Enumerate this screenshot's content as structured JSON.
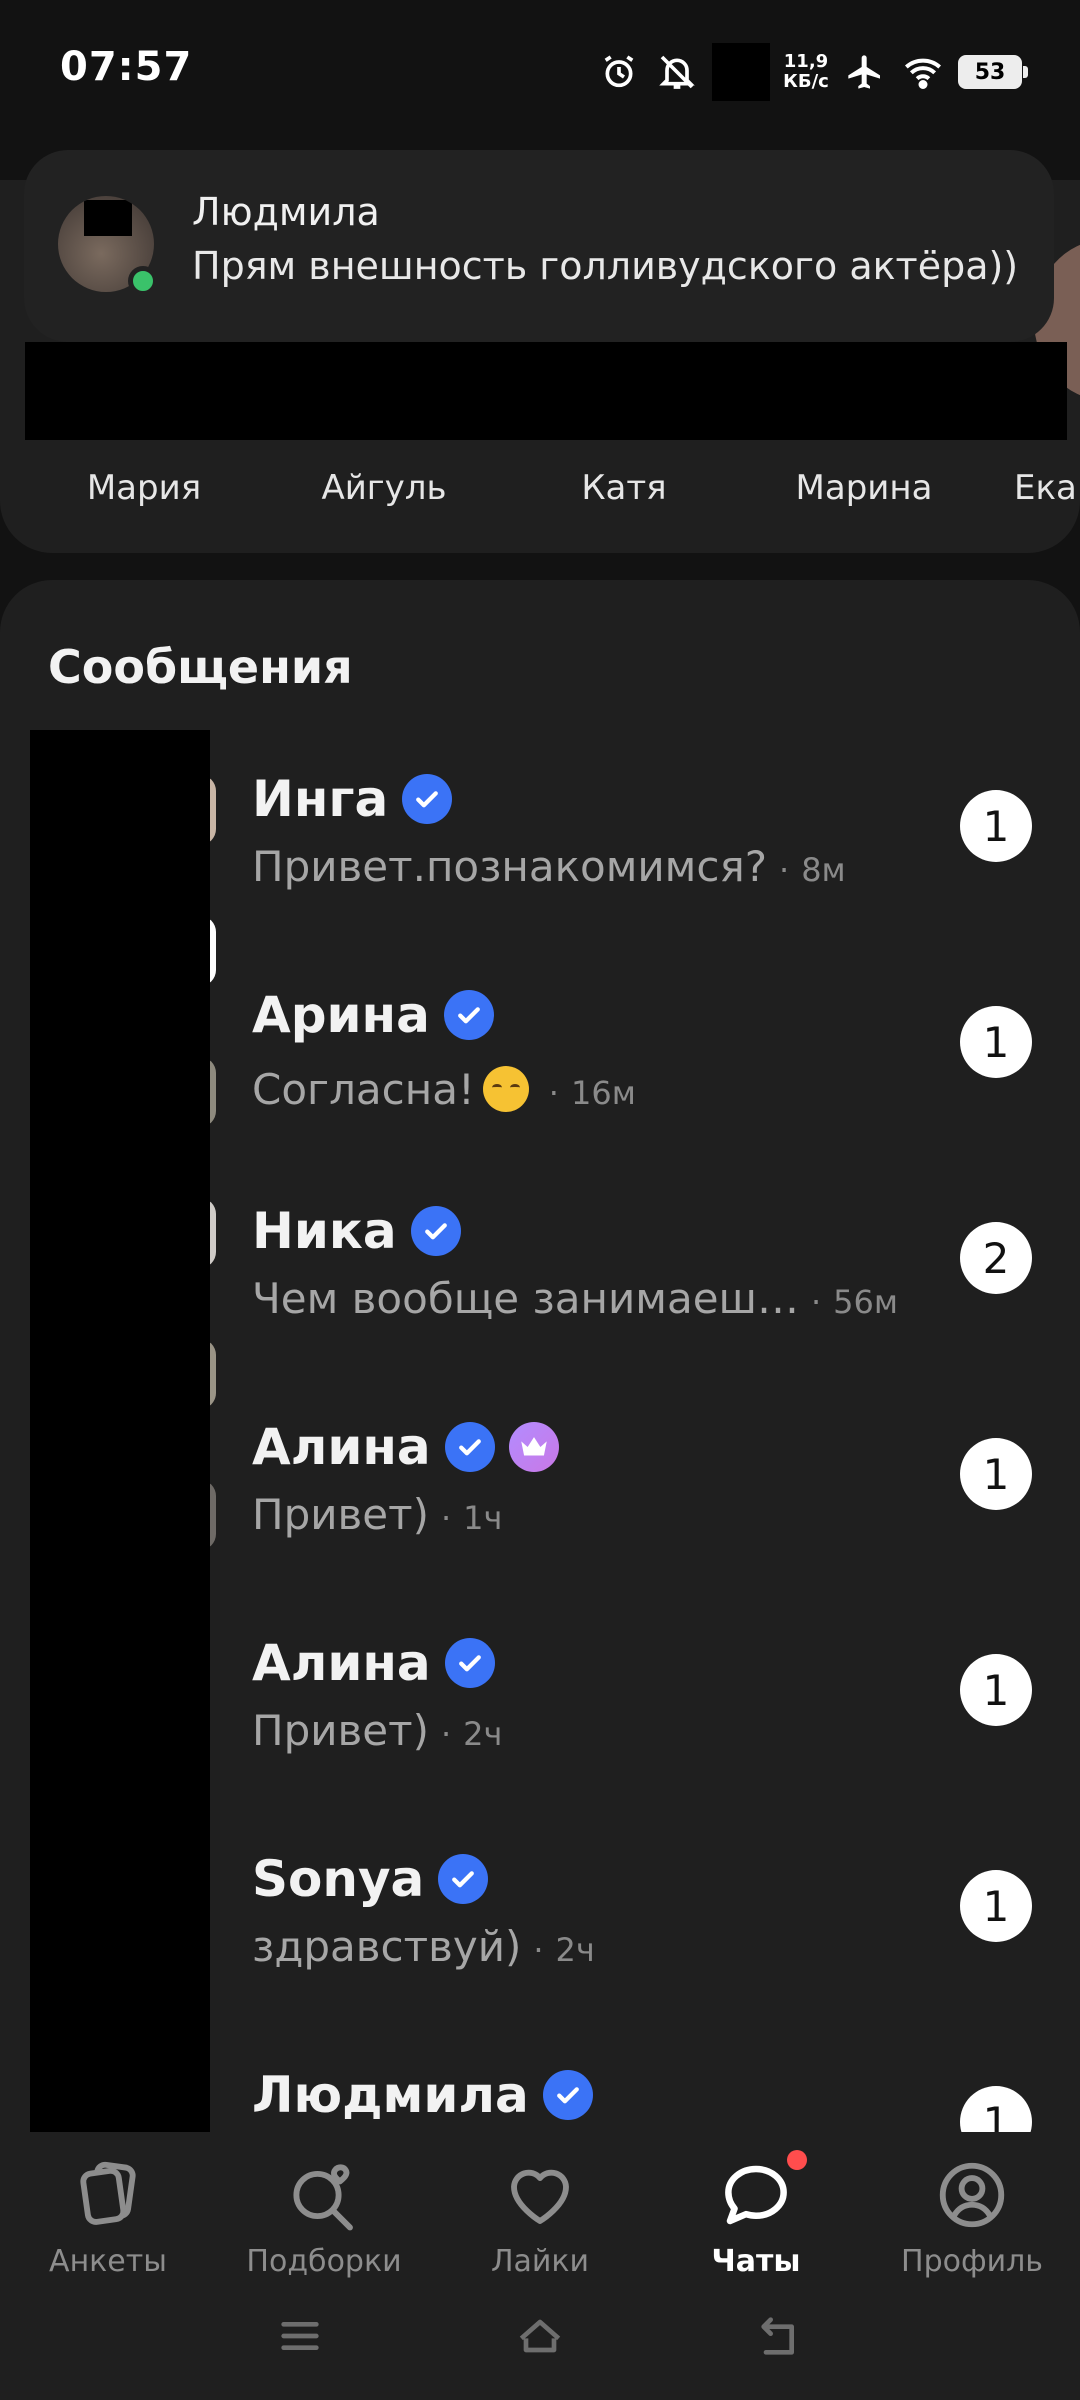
{
  "status_bar": {
    "time": "07:57",
    "net_speed_value": "11,9",
    "net_speed_unit": "КБ/с",
    "battery": "53"
  },
  "notification": {
    "sender": "Людмила",
    "text": "Прям внешность голливудского актёра))"
  },
  "stories": [
    {
      "name": "Мария"
    },
    {
      "name": "Айгуль"
    },
    {
      "name": "Катя"
    },
    {
      "name": "Марина"
    },
    {
      "name": "Ека"
    }
  ],
  "messages": {
    "title": "Сообщения",
    "chats": [
      {
        "name": "Инга",
        "preview": "Привет.познакомимся?",
        "time": "8м",
        "unread": "1"
      },
      {
        "name": "Арина",
        "preview": "Согласна!",
        "time": "16м",
        "unread": "1"
      },
      {
        "name": "Ника",
        "preview": "Чем вообще занимаеш…",
        "time": "56м",
        "unread": "2"
      },
      {
        "name": "Алина",
        "preview": "Привет)",
        "time": "1ч",
        "unread": "1"
      },
      {
        "name": "Алина",
        "preview": "Привет)",
        "time": "2ч",
        "unread": "1"
      },
      {
        "name": "Sonya",
        "preview": "здравствуй)",
        "time": "2ч",
        "unread": "1"
      },
      {
        "name": "Людмила",
        "preview": "",
        "time": "",
        "unread": "1"
      }
    ]
  },
  "bottom_nav": {
    "items": [
      {
        "label": "Анкеты",
        "icon": "cards-icon"
      },
      {
        "label": "Подборки",
        "icon": "search-heart-icon"
      },
      {
        "label": "Лайки",
        "icon": "heart-icon"
      },
      {
        "label": "Чаты",
        "icon": "chat-icon",
        "active": true
      },
      {
        "label": "Профиль",
        "icon": "profile-icon"
      }
    ]
  }
}
